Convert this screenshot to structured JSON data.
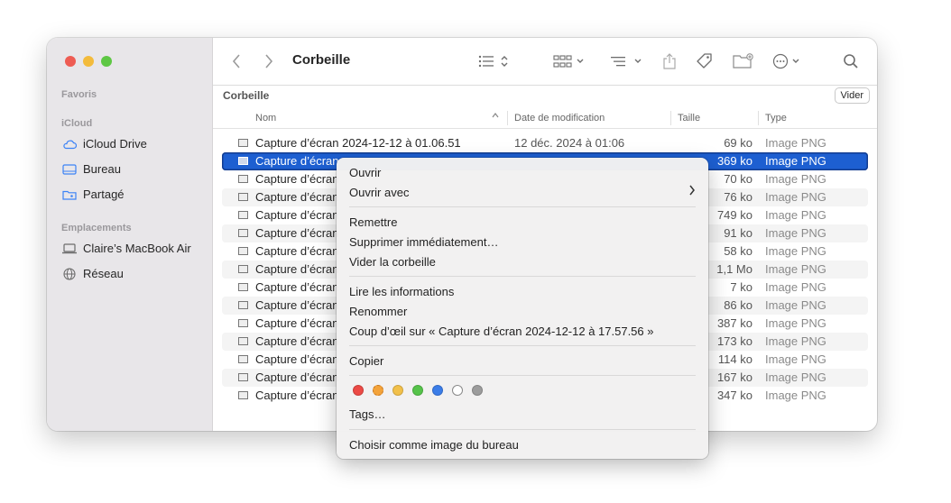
{
  "window": {
    "title": "Corbeille"
  },
  "sidebar": {
    "favoris": "Favoris",
    "icloud": "iCloud",
    "icloud_items": [
      {
        "label": "iCloud Drive",
        "icon": "cloud-icon"
      },
      {
        "label": "Bureau",
        "icon": "desktop-icon"
      },
      {
        "label": "Partagé",
        "icon": "shared-folder-icon"
      }
    ],
    "emplacements": "Emplacements",
    "location_items": [
      {
        "label": "Claire’s MacBook Air",
        "icon": "laptop-icon"
      },
      {
        "label": "Réseau",
        "icon": "network-icon"
      }
    ]
  },
  "pathbar": {
    "label": "Corbeille",
    "empty_button": "Vider"
  },
  "columns": {
    "name": "Nom",
    "date": "Date de modification",
    "size": "Taille",
    "type": "Type"
  },
  "files": [
    {
      "name": "Capture d’écran 2024-12-12 à 01.06.51",
      "date": "12 déc. 2024 à 01:06",
      "size": "69 ko",
      "type": "Image PNG"
    },
    {
      "name": "Capture d’écran",
      "date": "",
      "size": "369 ko",
      "type": "Image PNG",
      "selected": true
    },
    {
      "name": "Capture d’écran",
      "date": "",
      "size": "70 ko",
      "type": "Image PNG"
    },
    {
      "name": "Capture d’écran",
      "date": "",
      "size": "76 ko",
      "type": "Image PNG"
    },
    {
      "name": "Capture d’écran",
      "date": "",
      "size": "749 ko",
      "type": "Image PNG"
    },
    {
      "name": "Capture d’écran",
      "date": "",
      "size": "91 ko",
      "type": "Image PNG"
    },
    {
      "name": "Capture d’écran",
      "date": "",
      "size": "58 ko",
      "type": "Image PNG"
    },
    {
      "name": "Capture d’écran",
      "date": "",
      "size": "1,1 Mo",
      "type": "Image PNG"
    },
    {
      "name": "Capture d’écran",
      "date": "",
      "size": "7 ko",
      "type": "Image PNG"
    },
    {
      "name": "Capture d’écran",
      "date": "",
      "size": "86 ko",
      "type": "Image PNG"
    },
    {
      "name": "Capture d’écran",
      "date": "",
      "size": "387 ko",
      "type": "Image PNG"
    },
    {
      "name": "Capture d’écran",
      "date": "",
      "size": "173 ko",
      "type": "Image PNG"
    },
    {
      "name": "Capture d’écran",
      "date": "",
      "size": "114 ko",
      "type": "Image PNG"
    },
    {
      "name": "Capture d’écran",
      "date": "",
      "size": "167 ko",
      "type": "Image PNG"
    },
    {
      "name": "Capture d’écran",
      "date": "",
      "size": "347 ko",
      "type": "Image PNG"
    }
  ],
  "context_menu": {
    "open": "Ouvrir",
    "open_with": "Ouvrir avec",
    "put_back": "Remettre",
    "delete_now": "Supprimer immédiatement…",
    "empty_trash": "Vider la corbeille",
    "get_info": "Lire les informations",
    "rename": "Renommer",
    "quick_look": "Coup d’œil sur « Capture d’écran 2024-12-12 à 17.57.56 »",
    "copy": "Copier",
    "tag_colors": [
      "#ec4a45",
      "#f3a33a",
      "#f2c04a",
      "#56c34a",
      "#3b7de8",
      "#ffffff",
      "#9c9c9c"
    ],
    "tags": "Tags…",
    "set_desktop": "Choisir comme image du bureau"
  }
}
